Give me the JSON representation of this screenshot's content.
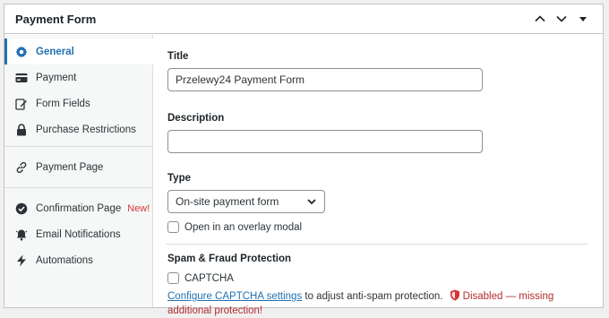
{
  "header": {
    "title": "Payment Form"
  },
  "sidebar": {
    "groups": [
      [
        {
          "label": "General",
          "icon": "gear-icon",
          "active": true
        },
        {
          "label": "Payment",
          "icon": "credit-card-icon"
        },
        {
          "label": "Form Fields",
          "icon": "edit-icon"
        },
        {
          "label": "Purchase Restrictions",
          "icon": "lock-icon"
        }
      ],
      [
        {
          "label": "Payment Page",
          "icon": "link-icon"
        }
      ],
      [
        {
          "label": "Confirmation Page",
          "icon": "check-circle-icon",
          "badge": "New!"
        },
        {
          "label": "Email Notifications",
          "icon": "bell-icon"
        },
        {
          "label": "Automations",
          "icon": "bolt-icon"
        }
      ]
    ]
  },
  "form": {
    "title_label": "Title",
    "title_value": "Przelewy24 Payment Form",
    "description_label": "Description",
    "description_value": "",
    "type_label": "Type",
    "type_value": "On-site payment form",
    "overlay_label": "Open in an overlay modal",
    "spam_label": "Spam & Fraud Protection",
    "captcha_label": "CAPTCHA",
    "captcha_link": "Configure CAPTCHA settings",
    "captcha_help": " to adjust anti-spam protection.",
    "captcha_status": "Disabled — missing additional protection!"
  },
  "colors": {
    "accent": "#2271b1",
    "danger": "#d63638"
  }
}
